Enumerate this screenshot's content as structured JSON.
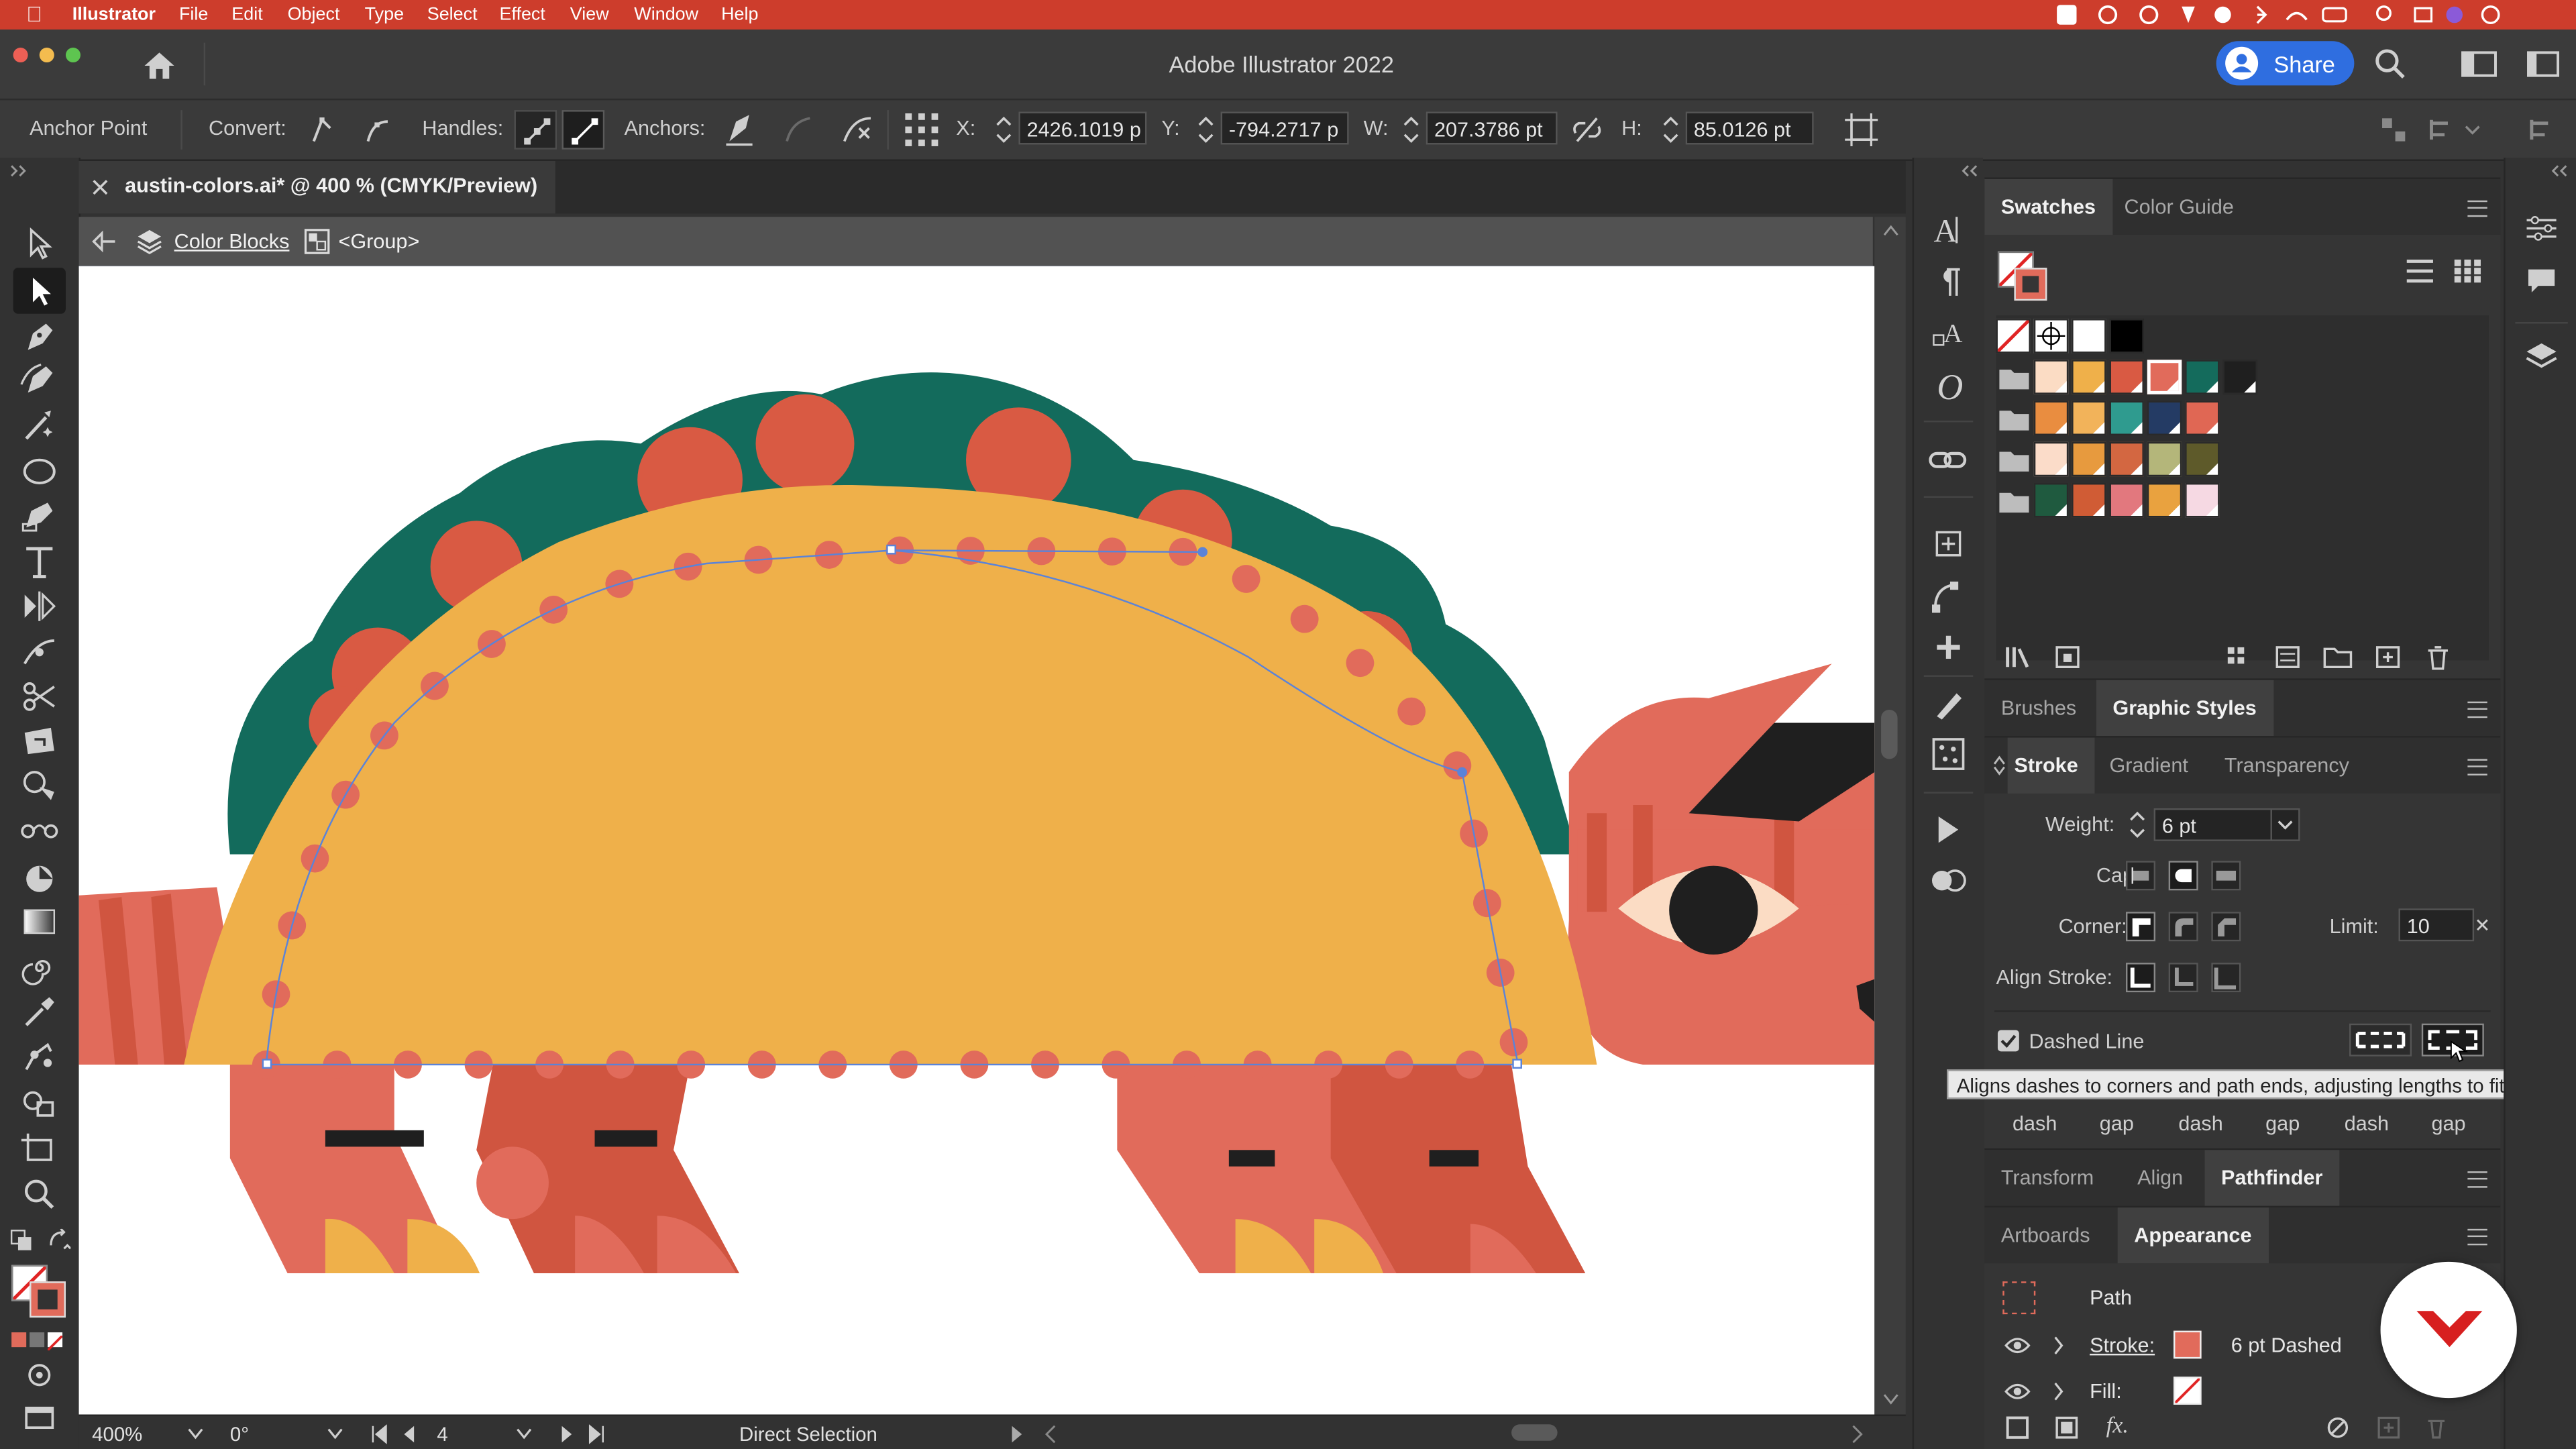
{
  "menubar": {
    "app": "Illustrator",
    "items": [
      "File",
      "Edit",
      "Object",
      "Type",
      "Select",
      "Effect",
      "View",
      "Window",
      "Help"
    ]
  },
  "titlebar": {
    "title": "Adobe Illustrator 2022",
    "share_label": "Share"
  },
  "control": {
    "mode": "Anchor Point",
    "convert_label": "Convert:",
    "handles_label": "Handles:",
    "anchors_label": "Anchors:",
    "x_label": "X:",
    "x_value": "2426.1019 p",
    "y_label": "Y:",
    "y_value": "-794.2717 p",
    "w_label": "W:",
    "w_value": "207.3786 pt",
    "h_label": "H:",
    "h_value": "85.0126 pt"
  },
  "document": {
    "tab_title": "austin-colors.ai* @ 400 % (CMYK/Preview)",
    "breadcrumb_layer": "Color Blocks",
    "breadcrumb_group": "<Group>"
  },
  "status": {
    "zoom": "400%",
    "rotation": "0°",
    "artboard": "4",
    "tool": "Direct Selection"
  },
  "swatches": {
    "tabs": [
      "Swatches",
      "Color Guide"
    ],
    "rows": [
      [
        "none",
        "registration",
        "#ffffff",
        "#000000"
      ],
      [
        "#fbdcc4",
        "#efb04a",
        "#d95a43",
        "#e16b5b",
        "#146b5c",
        "#1f1f1f"
      ],
      [
        "#e98d40",
        "#f2b35a",
        "#2f9b8f",
        "#243b64",
        "#e06754"
      ],
      [
        "#fbdcc9",
        "#e79a3e",
        "#d36741",
        "#b4b67a",
        "#5e5a2a"
      ],
      [
        "#1f5a3f",
        "#d05c35",
        "#e2787e",
        "#e9a23f",
        "#f6d9e3"
      ]
    ]
  },
  "brushes": {
    "tabs": [
      "Brushes",
      "Graphic Styles"
    ]
  },
  "stroke": {
    "tabs": [
      "Stroke",
      "Gradient",
      "Transparency"
    ],
    "weight_label": "Weight:",
    "weight_value": "6 pt",
    "cap_label": "Cap:",
    "corner_label": "Corner:",
    "limit_label": "Limit:",
    "limit_value": "10",
    "align_label": "Align Stroke:",
    "dashed_label": "Dashed Line",
    "dash_fields": [
      "dash",
      "gap",
      "dash",
      "gap",
      "dash",
      "gap"
    ]
  },
  "tooltip": "Aligns dashes to corners and path ends, adjusting lengths to fit",
  "transform": {
    "tabs": [
      "Transform",
      "Align",
      "Pathfinder"
    ]
  },
  "appearance": {
    "tabs": [
      "Artboards",
      "Appearance"
    ],
    "object": "Path",
    "stroke_label": "Stroke:",
    "stroke_value": "6 pt Dashed",
    "fill_label": "Fill:"
  },
  "colors": {
    "menubar": "#cd3d2c",
    "share": "#2f6ee0",
    "selection": "#4a78d4"
  }
}
